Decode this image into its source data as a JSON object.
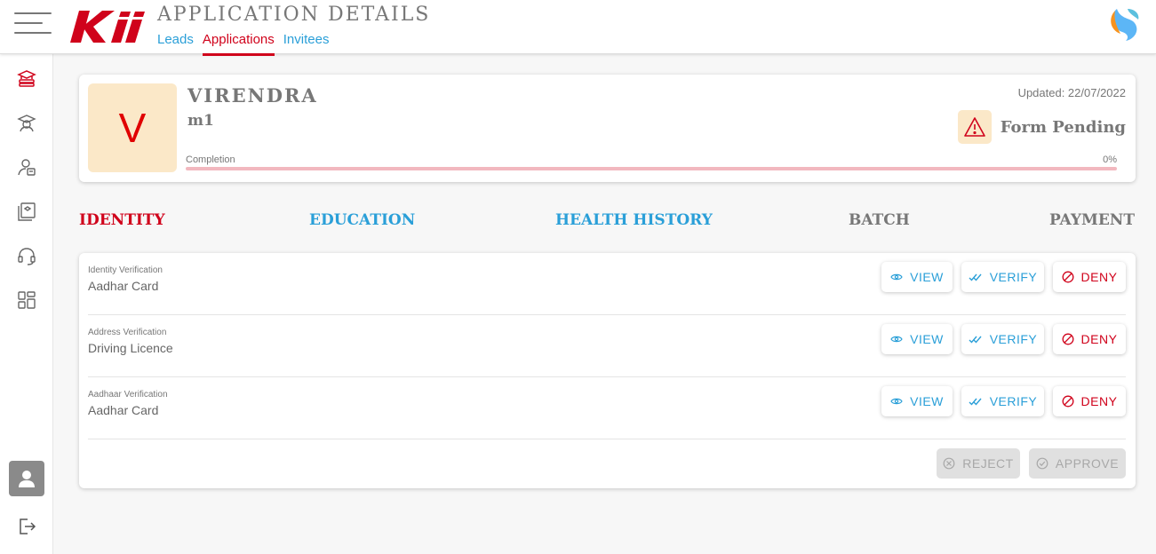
{
  "header": {
    "title": "APPLICATION DETAILS",
    "nav": [
      {
        "label": "Leads",
        "active": false
      },
      {
        "label": "Applications",
        "active": true
      },
      {
        "label": "Invitees",
        "active": false
      }
    ],
    "brand_color": "#d0021b",
    "link_color": "#2a9fd8"
  },
  "sidebar": {
    "items": [
      {
        "icon": "graduation-books-icon",
        "active": true
      },
      {
        "icon": "student-icon",
        "active": false
      },
      {
        "icon": "user-id-icon",
        "active": false
      },
      {
        "icon": "book-stack-icon",
        "active": false
      },
      {
        "icon": "headset-icon",
        "active": false
      },
      {
        "icon": "grid-icon",
        "active": false
      }
    ],
    "bottom": [
      "user-avatar-icon",
      "logout-icon"
    ]
  },
  "profile": {
    "initial": "V",
    "name": "VIRENDRA",
    "course": "m1",
    "updated": "Updated: 22/07/2022",
    "status": "Form Pending",
    "completion_label": "Completion",
    "completion_percent_text": "0%",
    "completion_value": 0
  },
  "tabs": [
    {
      "label": "IDENTITY",
      "color": "#d0021b"
    },
    {
      "label": "EDUCATION",
      "color": "#2a9fd8"
    },
    {
      "label": "HEALTH HISTORY",
      "color": "#2a9fd8"
    },
    {
      "label": "BATCH",
      "color": "#777777"
    },
    {
      "label": "PAYMENT",
      "color": "#777777"
    }
  ],
  "documents": [
    {
      "type": "Identity Verification",
      "name": "Aadhar Card"
    },
    {
      "type": "Address Verification",
      "name": "Driving Licence"
    },
    {
      "type": "Aadhaar Verification",
      "name": "Aadhar Card"
    }
  ],
  "actions": {
    "view": "VIEW",
    "verify": "VERIFY",
    "deny": "DENY",
    "reject": "REJECT",
    "approve": "APPROVE"
  }
}
